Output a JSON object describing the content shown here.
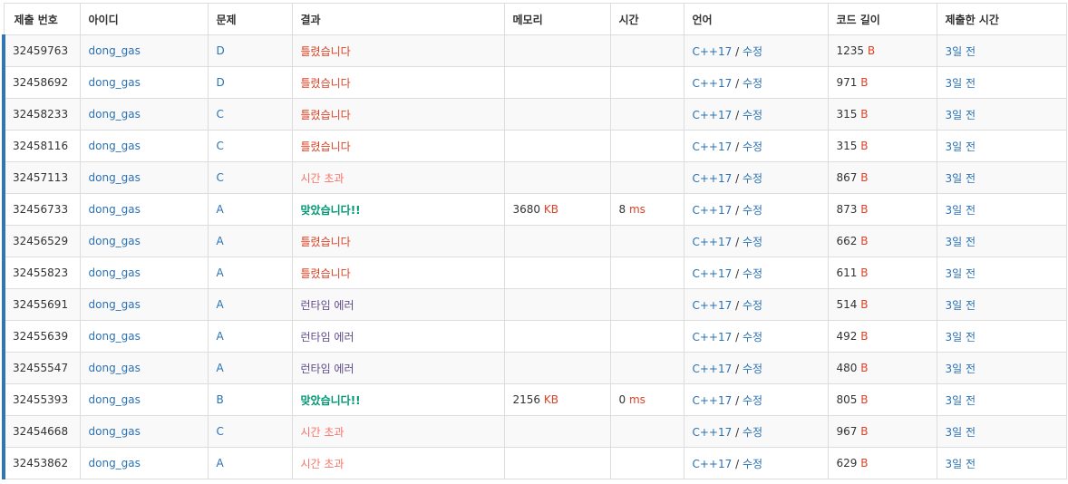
{
  "headers": [
    "제출 번호",
    "아이디",
    "문제",
    "결과",
    "메모리",
    "시간",
    "언어",
    "코드 길이",
    "제출한 시간"
  ],
  "language_edit_label": "수정",
  "language_separator": " / ",
  "memory_unit": "KB",
  "time_unit": "ms",
  "length_unit": "B",
  "rows": [
    {
      "id": "32459763",
      "user": "dong_gas",
      "problem": "D",
      "result": "틀렸습니다",
      "result_type": "wrong",
      "memory": "",
      "time": "",
      "language": "C++17",
      "length": "1235",
      "submitted": "3일 전"
    },
    {
      "id": "32458692",
      "user": "dong_gas",
      "problem": "D",
      "result": "틀렸습니다",
      "result_type": "wrong",
      "memory": "",
      "time": "",
      "language": "C++17",
      "length": "971",
      "submitted": "3일 전"
    },
    {
      "id": "32458233",
      "user": "dong_gas",
      "problem": "C",
      "result": "틀렸습니다",
      "result_type": "wrong",
      "memory": "",
      "time": "",
      "language": "C++17",
      "length": "315",
      "submitted": "3일 전"
    },
    {
      "id": "32458116",
      "user": "dong_gas",
      "problem": "C",
      "result": "틀렸습니다",
      "result_type": "wrong",
      "memory": "",
      "time": "",
      "language": "C++17",
      "length": "315",
      "submitted": "3일 전"
    },
    {
      "id": "32457113",
      "user": "dong_gas",
      "problem": "C",
      "result": "시간 초과",
      "result_type": "tle",
      "memory": "",
      "time": "",
      "language": "C++17",
      "length": "867",
      "submitted": "3일 전"
    },
    {
      "id": "32456733",
      "user": "dong_gas",
      "problem": "A",
      "result": "맞았습니다!!",
      "result_type": "ac",
      "memory": "3680",
      "time": "8",
      "language": "C++17",
      "length": "873",
      "submitted": "3일 전"
    },
    {
      "id": "32456529",
      "user": "dong_gas",
      "problem": "A",
      "result": "틀렸습니다",
      "result_type": "wrong",
      "memory": "",
      "time": "",
      "language": "C++17",
      "length": "662",
      "submitted": "3일 전"
    },
    {
      "id": "32455823",
      "user": "dong_gas",
      "problem": "A",
      "result": "틀렸습니다",
      "result_type": "wrong",
      "memory": "",
      "time": "",
      "language": "C++17",
      "length": "611",
      "submitted": "3일 전"
    },
    {
      "id": "32455691",
      "user": "dong_gas",
      "problem": "A",
      "result": "런타임 에러",
      "result_type": "rte",
      "memory": "",
      "time": "",
      "language": "C++17",
      "length": "514",
      "submitted": "3일 전"
    },
    {
      "id": "32455639",
      "user": "dong_gas",
      "problem": "A",
      "result": "런타임 에러",
      "result_type": "rte",
      "memory": "",
      "time": "",
      "language": "C++17",
      "length": "492",
      "submitted": "3일 전"
    },
    {
      "id": "32455547",
      "user": "dong_gas",
      "problem": "A",
      "result": "런타임 에러",
      "result_type": "rte",
      "memory": "",
      "time": "",
      "language": "C++17",
      "length": "480",
      "submitted": "3일 전"
    },
    {
      "id": "32455393",
      "user": "dong_gas",
      "problem": "B",
      "result": "맞았습니다!!",
      "result_type": "ac",
      "memory": "2156",
      "time": "0",
      "language": "C++17",
      "length": "805",
      "submitted": "3일 전"
    },
    {
      "id": "32454668",
      "user": "dong_gas",
      "problem": "C",
      "result": "시간 초과",
      "result_type": "tle",
      "memory": "",
      "time": "",
      "language": "C++17",
      "length": "967",
      "submitted": "3일 전"
    },
    {
      "id": "32453862",
      "user": "dong_gas",
      "problem": "A",
      "result": "시간 초과",
      "result_type": "tle",
      "memory": "",
      "time": "",
      "language": "C++17",
      "length": "629",
      "submitted": "3일 전"
    }
  ],
  "colors": {
    "link": "#2b72b4",
    "wrong": "#dd4124",
    "tle": "#fa7268",
    "accepted": "#009874",
    "runtime_error": "#5f4b8b",
    "row_accent": "#3276b1"
  }
}
